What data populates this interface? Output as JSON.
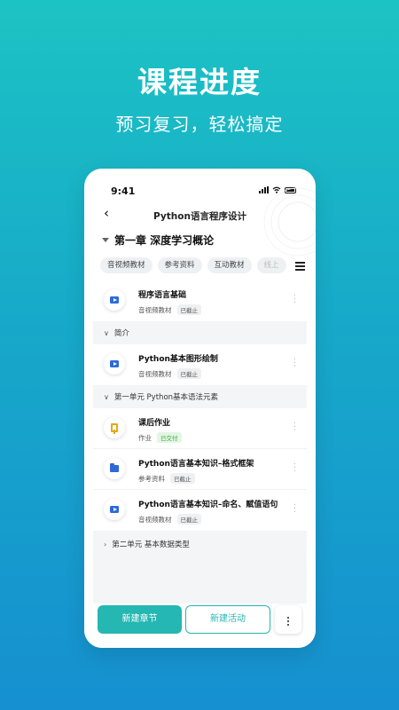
{
  "promo": {
    "headline": "课程进度",
    "subline": "预习复习，轻松搞定"
  },
  "status_bar": {
    "time": "9:41"
  },
  "nav": {
    "back_icon": "chevron-left-icon",
    "title": "Python语言程序设计"
  },
  "chapter": {
    "title": "第一章 深度学习概论"
  },
  "tags": [
    "音视频教材",
    "参考资料",
    "互动教材",
    "线上"
  ],
  "items": [
    {
      "title": "程序语言基础",
      "type": "音视频教材",
      "badge": "已截止",
      "icon": "play-icon"
    },
    {
      "title": "Python基本图形绘制",
      "type": "音视频教材",
      "badge": "已截止",
      "icon": "play-icon"
    },
    {
      "title": "课后作业",
      "type": "作业",
      "badge": "已交付",
      "icon": "homework-icon"
    },
    {
      "title": "Python语言基本知识–格式框架",
      "type": "参考资料",
      "badge": "已截止",
      "icon": "folder-icon"
    },
    {
      "title": "Python语言基本知识–命名、赋值语句",
      "type": "音视频教材",
      "badge": "已截止",
      "icon": "play-icon"
    }
  ],
  "sections": [
    {
      "label": "简介",
      "expanded": true
    },
    {
      "label": "第一单元 Python基本语法元素",
      "expanded": true
    },
    {
      "label": "第二单元 基本数据类型",
      "expanded": false
    }
  ],
  "bottom": {
    "new_chapter": "新建章节",
    "new_activity": "新建活动"
  },
  "colors": {
    "accent": "#25b7b2",
    "icon_blue": "#2d6ad8",
    "homework_yellow": "#e4a915",
    "success_green": "#37a53b"
  }
}
